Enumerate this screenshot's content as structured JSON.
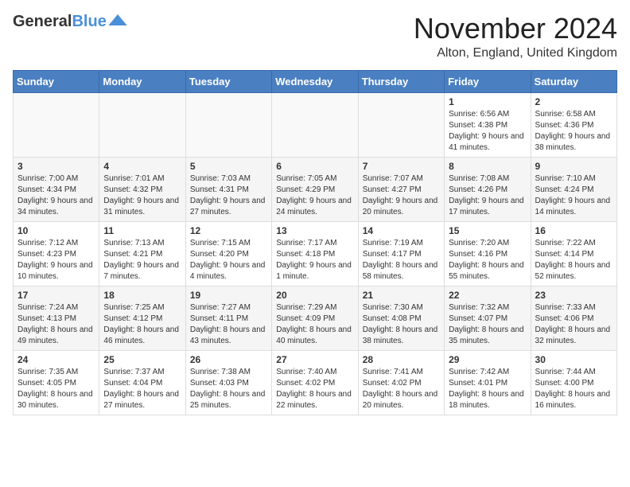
{
  "header": {
    "logo_line1": "General",
    "logo_line2": "Blue",
    "month_title": "November 2024",
    "location": "Alton, England, United Kingdom"
  },
  "days_of_week": [
    "Sunday",
    "Monday",
    "Tuesday",
    "Wednesday",
    "Thursday",
    "Friday",
    "Saturday"
  ],
  "weeks": [
    [
      {
        "day": "",
        "info": ""
      },
      {
        "day": "",
        "info": ""
      },
      {
        "day": "",
        "info": ""
      },
      {
        "day": "",
        "info": ""
      },
      {
        "day": "",
        "info": ""
      },
      {
        "day": "1",
        "info": "Sunrise: 6:56 AM\nSunset: 4:38 PM\nDaylight: 9 hours and 41 minutes."
      },
      {
        "day": "2",
        "info": "Sunrise: 6:58 AM\nSunset: 4:36 PM\nDaylight: 9 hours and 38 minutes."
      }
    ],
    [
      {
        "day": "3",
        "info": "Sunrise: 7:00 AM\nSunset: 4:34 PM\nDaylight: 9 hours and 34 minutes."
      },
      {
        "day": "4",
        "info": "Sunrise: 7:01 AM\nSunset: 4:32 PM\nDaylight: 9 hours and 31 minutes."
      },
      {
        "day": "5",
        "info": "Sunrise: 7:03 AM\nSunset: 4:31 PM\nDaylight: 9 hours and 27 minutes."
      },
      {
        "day": "6",
        "info": "Sunrise: 7:05 AM\nSunset: 4:29 PM\nDaylight: 9 hours and 24 minutes."
      },
      {
        "day": "7",
        "info": "Sunrise: 7:07 AM\nSunset: 4:27 PM\nDaylight: 9 hours and 20 minutes."
      },
      {
        "day": "8",
        "info": "Sunrise: 7:08 AM\nSunset: 4:26 PM\nDaylight: 9 hours and 17 minutes."
      },
      {
        "day": "9",
        "info": "Sunrise: 7:10 AM\nSunset: 4:24 PM\nDaylight: 9 hours and 14 minutes."
      }
    ],
    [
      {
        "day": "10",
        "info": "Sunrise: 7:12 AM\nSunset: 4:23 PM\nDaylight: 9 hours and 10 minutes."
      },
      {
        "day": "11",
        "info": "Sunrise: 7:13 AM\nSunset: 4:21 PM\nDaylight: 9 hours and 7 minutes."
      },
      {
        "day": "12",
        "info": "Sunrise: 7:15 AM\nSunset: 4:20 PM\nDaylight: 9 hours and 4 minutes."
      },
      {
        "day": "13",
        "info": "Sunrise: 7:17 AM\nSunset: 4:18 PM\nDaylight: 9 hours and 1 minute."
      },
      {
        "day": "14",
        "info": "Sunrise: 7:19 AM\nSunset: 4:17 PM\nDaylight: 8 hours and 58 minutes."
      },
      {
        "day": "15",
        "info": "Sunrise: 7:20 AM\nSunset: 4:16 PM\nDaylight: 8 hours and 55 minutes."
      },
      {
        "day": "16",
        "info": "Sunrise: 7:22 AM\nSunset: 4:14 PM\nDaylight: 8 hours and 52 minutes."
      }
    ],
    [
      {
        "day": "17",
        "info": "Sunrise: 7:24 AM\nSunset: 4:13 PM\nDaylight: 8 hours and 49 minutes."
      },
      {
        "day": "18",
        "info": "Sunrise: 7:25 AM\nSunset: 4:12 PM\nDaylight: 8 hours and 46 minutes."
      },
      {
        "day": "19",
        "info": "Sunrise: 7:27 AM\nSunset: 4:11 PM\nDaylight: 8 hours and 43 minutes."
      },
      {
        "day": "20",
        "info": "Sunrise: 7:29 AM\nSunset: 4:09 PM\nDaylight: 8 hours and 40 minutes."
      },
      {
        "day": "21",
        "info": "Sunrise: 7:30 AM\nSunset: 4:08 PM\nDaylight: 8 hours and 38 minutes."
      },
      {
        "day": "22",
        "info": "Sunrise: 7:32 AM\nSunset: 4:07 PM\nDaylight: 8 hours and 35 minutes."
      },
      {
        "day": "23",
        "info": "Sunrise: 7:33 AM\nSunset: 4:06 PM\nDaylight: 8 hours and 32 minutes."
      }
    ],
    [
      {
        "day": "24",
        "info": "Sunrise: 7:35 AM\nSunset: 4:05 PM\nDaylight: 8 hours and 30 minutes."
      },
      {
        "day": "25",
        "info": "Sunrise: 7:37 AM\nSunset: 4:04 PM\nDaylight: 8 hours and 27 minutes."
      },
      {
        "day": "26",
        "info": "Sunrise: 7:38 AM\nSunset: 4:03 PM\nDaylight: 8 hours and 25 minutes."
      },
      {
        "day": "27",
        "info": "Sunrise: 7:40 AM\nSunset: 4:02 PM\nDaylight: 8 hours and 22 minutes."
      },
      {
        "day": "28",
        "info": "Sunrise: 7:41 AM\nSunset: 4:02 PM\nDaylight: 8 hours and 20 minutes."
      },
      {
        "day": "29",
        "info": "Sunrise: 7:42 AM\nSunset: 4:01 PM\nDaylight: 8 hours and 18 minutes."
      },
      {
        "day": "30",
        "info": "Sunrise: 7:44 AM\nSunset: 4:00 PM\nDaylight: 8 hours and 16 minutes."
      }
    ]
  ]
}
